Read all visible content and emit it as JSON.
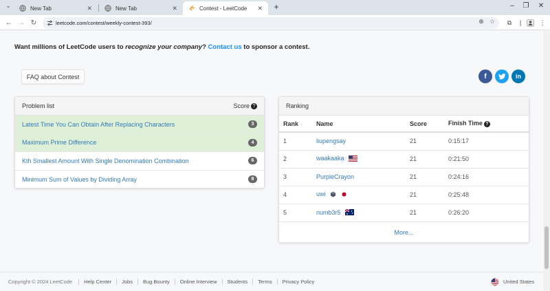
{
  "browser": {
    "tabs": [
      {
        "title": "New Tab",
        "active": false
      },
      {
        "title": "New Tab",
        "active": false
      },
      {
        "title": "Contest - LeetCode",
        "active": true
      }
    ],
    "new_tab_label": "+",
    "url": "leetcode.com/contest/weekly-contest-393/"
  },
  "sponsor": {
    "prefix": "Want millions of LeetCode users to ",
    "emphasis": "recognize your company",
    "middle": "? ",
    "link": "Contact us",
    "suffix": " to sponsor a contest."
  },
  "faq_label": "FAQ about Contest",
  "social": [
    {
      "icon": "facebook-icon",
      "glyph": "f",
      "color": "#3b5998"
    },
    {
      "icon": "twitter-icon",
      "glyph": "t",
      "color": "#1da1f2"
    },
    {
      "icon": "linkedin-icon",
      "glyph": "in",
      "color": "#0077b5"
    }
  ],
  "problem_list": {
    "header": "Problem list",
    "score_header": "Score",
    "items": [
      {
        "title": "Latest Time You Can Obtain After Replacing Characters",
        "score": "3",
        "solved": true
      },
      {
        "title": "Maximum Prime Difference",
        "score": "4",
        "solved": true
      },
      {
        "title": "Kth Smallest Amount With Single Denomination Combination",
        "score": "6",
        "solved": false
      },
      {
        "title": "Minimum Sum of Values by Dividing Array",
        "score": "8",
        "solved": false
      }
    ]
  },
  "ranking": {
    "header": "Ranking",
    "columns": {
      "rank": "Rank",
      "name": "Name",
      "score": "Score",
      "finish": "Finish Time"
    },
    "rows": [
      {
        "rank": "1",
        "name": "liupengsay",
        "score": "21",
        "finish": "0:15:17",
        "flag": ""
      },
      {
        "rank": "2",
        "name": "waakaaka",
        "score": "21",
        "finish": "0:21:50",
        "flag": "us-flag-icon"
      },
      {
        "rank": "3",
        "name": "PurpleCrayon",
        "score": "21",
        "finish": "0:24:16",
        "flag": ""
      },
      {
        "rank": "4",
        "name": "uwi",
        "score": "21",
        "finish": "0:25:48",
        "flag": "japan-flag-icon"
      },
      {
        "rank": "5",
        "name": "numb3r5",
        "score": "21",
        "finish": "0:26:20",
        "flag": "australia-flag-icon"
      }
    ],
    "more_label": "More..."
  },
  "footer": {
    "copyright": "Copyright © 2024 LeetCode",
    "links": [
      "Help Center",
      "Jobs",
      "Bug Bounty",
      "Online Interview",
      "Students",
      "Terms",
      "Privacy Policy"
    ],
    "locale": "United States"
  },
  "colors": {
    "accent": "#1a90ff",
    "link": "#337ab7",
    "solved_row": "#dff0d8"
  }
}
